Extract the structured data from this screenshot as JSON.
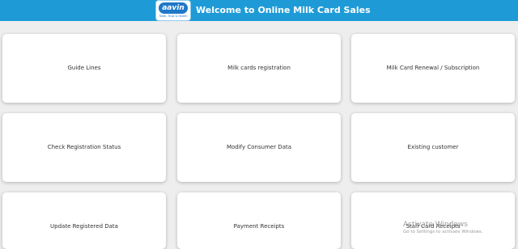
{
  "header": {
    "logo_text": "aavin",
    "logo_tagline": "Taste, Trust & Health",
    "title": "Welcome to Online Milk Card Sales",
    "accent_color": "#1e9bd7"
  },
  "cards": [
    {
      "label": "Guide Lines"
    },
    {
      "label": "Milk cards registration"
    },
    {
      "label": "Milk Card Renewal / Subscription"
    },
    {
      "label": "Check Registration Status"
    },
    {
      "label": "Modify Consumer Data"
    },
    {
      "label": "Existing customer"
    },
    {
      "label": "Update Registered Data"
    },
    {
      "label": "Payment Receipts"
    },
    {
      "label": "Staff Card Receipts"
    }
  ],
  "watermark": {
    "line1": "Activate Windows",
    "line2": "Go to Settings to activate Windows."
  }
}
